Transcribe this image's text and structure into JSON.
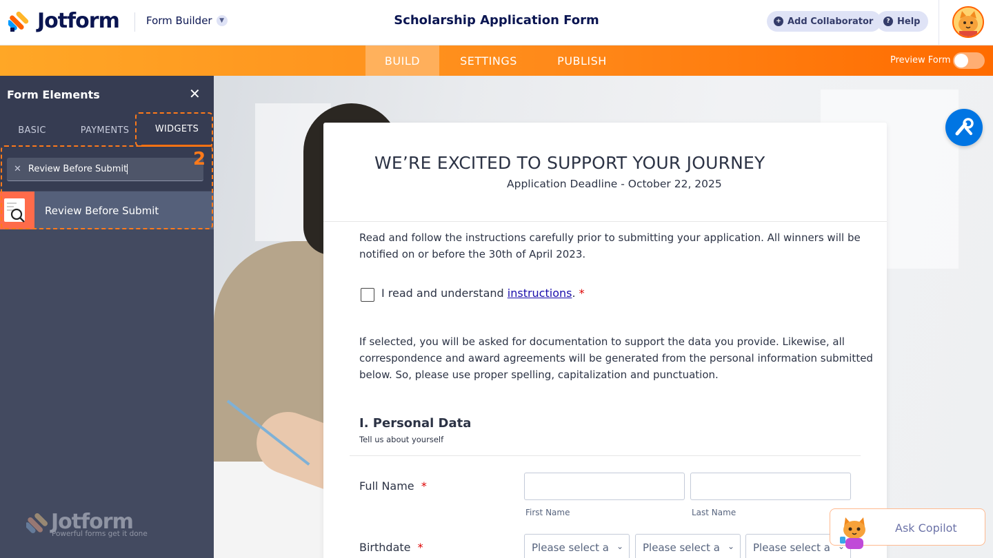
{
  "header": {
    "brand": "Jotform",
    "builder_label": "Form Builder",
    "form_title": "Scholarship Application Form",
    "add_collaborator": "Add Collaborator",
    "help": "Help"
  },
  "nav": {
    "tabs": [
      "BUILD",
      "SETTINGS",
      "PUBLISH"
    ],
    "active_tab": "BUILD",
    "preview_label": "Preview Form",
    "preview_on": false
  },
  "sidebar": {
    "title": "Form Elements",
    "tabs": [
      "BASIC",
      "PAYMENTS",
      "WIDGETS"
    ],
    "active_tab": "WIDGETS",
    "search_value": "Review Before Submit",
    "result_label": "Review Before Submit",
    "step_number": "2",
    "brand": "Jotform",
    "brand_tagline": "Powerful forms get it done"
  },
  "form": {
    "heading": "WE’RE EXCITED TO SUPPORT YOUR JOURNEY",
    "subheading": "Application Deadline - October 22, 2025",
    "intro_line1": "Read and follow the instructions carefully prior to submitting your application. All winners will be",
    "intro_line2": "notified on or before the 30th of April 2023.",
    "checkbox_prefix": "I read and understand ",
    "checkbox_link": "instructions",
    "checkbox_suffix": ".",
    "required_mark": "*",
    "note_line1": "If selected, you will be asked for documentation to support the data you provide. Likewise, all",
    "note_line2": "correspondence and award agreements will be generated from the personal information submitted",
    "note_line3": "below. So, please use proper spelling, capitalization and punctuation.",
    "section_title": "I. Personal Data",
    "section_subtitle": "Tell us about yourself",
    "full_name_label": "Full Name",
    "first_name_sublabel": "First Name",
    "last_name_sublabel": "Last Name",
    "birthdate_label": "Birthdate",
    "select_placeholder": "Please select a"
  },
  "copilot": {
    "label": "Ask Copilot"
  },
  "colors": {
    "accent": "#ff6100",
    "sidebar_bg": "#434a60",
    "fab_blue": "#0075e3"
  },
  "icons": [
    "jotform-logo-icon",
    "chevron-down-icon",
    "add-user-icon",
    "help-icon",
    "close-icon",
    "clear-search-icon",
    "review-widget-icon",
    "designer-wand-icon",
    "copilot-cat-icon"
  ]
}
